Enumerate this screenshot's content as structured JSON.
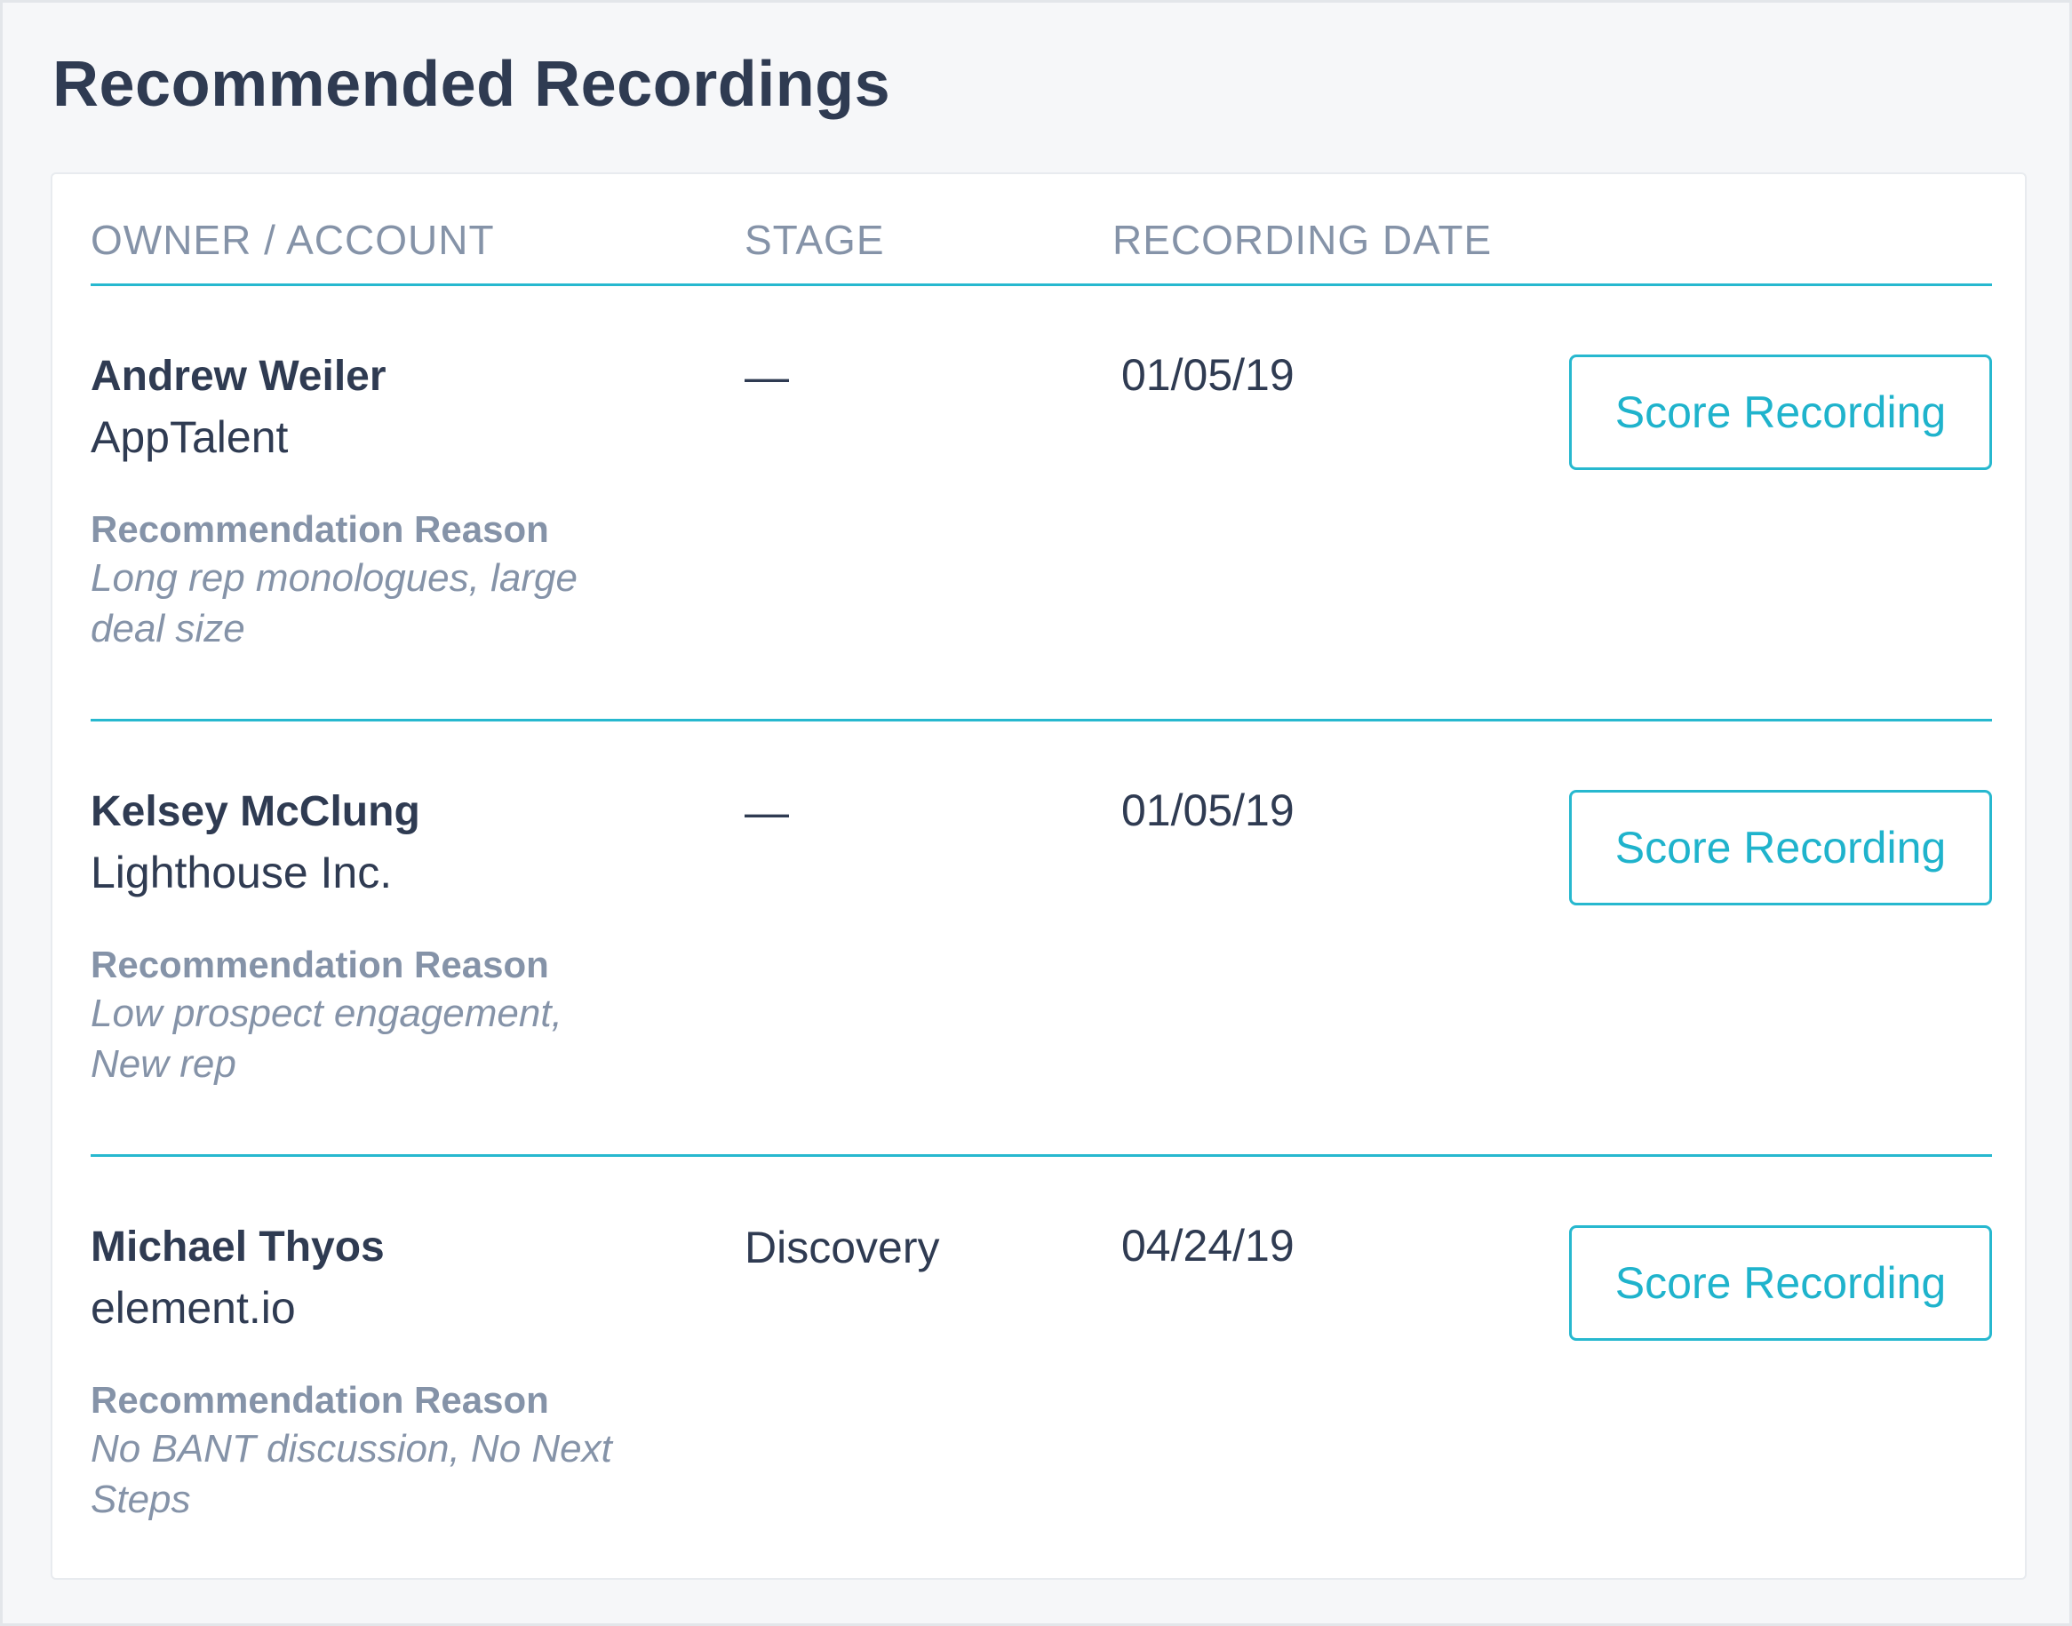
{
  "page": {
    "title": "Recommended Recordings"
  },
  "table": {
    "headers": {
      "owner_account": "OWNER / ACCOUNT",
      "stage": "STAGE",
      "recording_date": "RECORDING DATE"
    },
    "reason_label": "Recommendation Reason",
    "action_label": "Score Recording",
    "rows": [
      {
        "owner": "Andrew Weiler",
        "account": "AppTalent",
        "reason": "Long rep monologues, large deal size",
        "stage": "—",
        "date": "01/05/19"
      },
      {
        "owner": "Kelsey McClung",
        "account": "Lighthouse Inc.",
        "reason": "Low prospect engagement, New rep",
        "stage": "—",
        "date": "01/05/19"
      },
      {
        "owner": "Michael Thyos",
        "account": "element.io",
        "reason": "No BANT discussion, No Next Steps",
        "stage": "Discovery",
        "date": "04/24/19"
      }
    ]
  },
  "colors": {
    "accent": "#27b8cf",
    "text_primary": "#2f3b52",
    "text_muted": "#8593a8",
    "background": "#f6f7f9"
  }
}
